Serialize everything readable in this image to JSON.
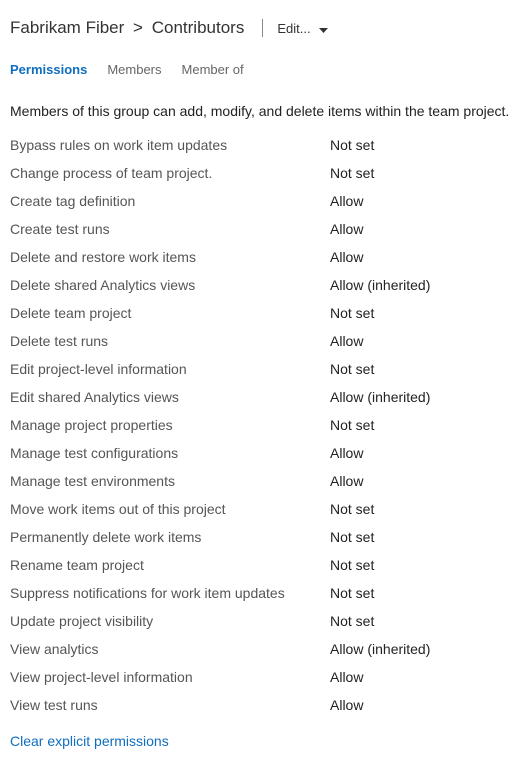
{
  "breadcrumb": {
    "project": "Fabrikam Fiber",
    "group": "Contributors"
  },
  "edit_menu": {
    "label": "Edit..."
  },
  "tabs": [
    {
      "key": "permissions",
      "label": "Permissions",
      "active": true
    },
    {
      "key": "members",
      "label": "Members",
      "active": false
    },
    {
      "key": "memberof",
      "label": "Member of",
      "active": false
    }
  ],
  "description": "Members of this group can add, modify, and delete items within the team project.",
  "permissions": [
    {
      "label": "Bypass rules on work item updates",
      "value": "Not set"
    },
    {
      "label": "Change process of team project.",
      "value": "Not set"
    },
    {
      "label": "Create tag definition",
      "value": "Allow"
    },
    {
      "label": "Create test runs",
      "value": "Allow"
    },
    {
      "label": "Delete and restore work items",
      "value": "Allow"
    },
    {
      "label": "Delete shared Analytics views",
      "value": "Allow (inherited)"
    },
    {
      "label": "Delete team project",
      "value": "Not set"
    },
    {
      "label": "Delete test runs",
      "value": "Allow"
    },
    {
      "label": "Edit project-level information",
      "value": "Not set"
    },
    {
      "label": "Edit shared Analytics views",
      "value": "Allow (inherited)"
    },
    {
      "label": "Manage project properties",
      "value": "Not set"
    },
    {
      "label": "Manage test configurations",
      "value": "Allow"
    },
    {
      "label": "Manage test environments",
      "value": "Allow"
    },
    {
      "label": "Move work items out of this project",
      "value": "Not set"
    },
    {
      "label": "Permanently delete work items",
      "value": "Not set"
    },
    {
      "label": "Rename team project",
      "value": "Not set"
    },
    {
      "label": "Suppress notifications for work item updates",
      "value": "Not set"
    },
    {
      "label": "Update project visibility",
      "value": "Not set"
    },
    {
      "label": "View analytics",
      "value": "Allow (inherited)"
    },
    {
      "label": "View project-level information",
      "value": "Allow"
    },
    {
      "label": "View test runs",
      "value": "Allow"
    }
  ],
  "clear_link": "Clear explicit permissions"
}
